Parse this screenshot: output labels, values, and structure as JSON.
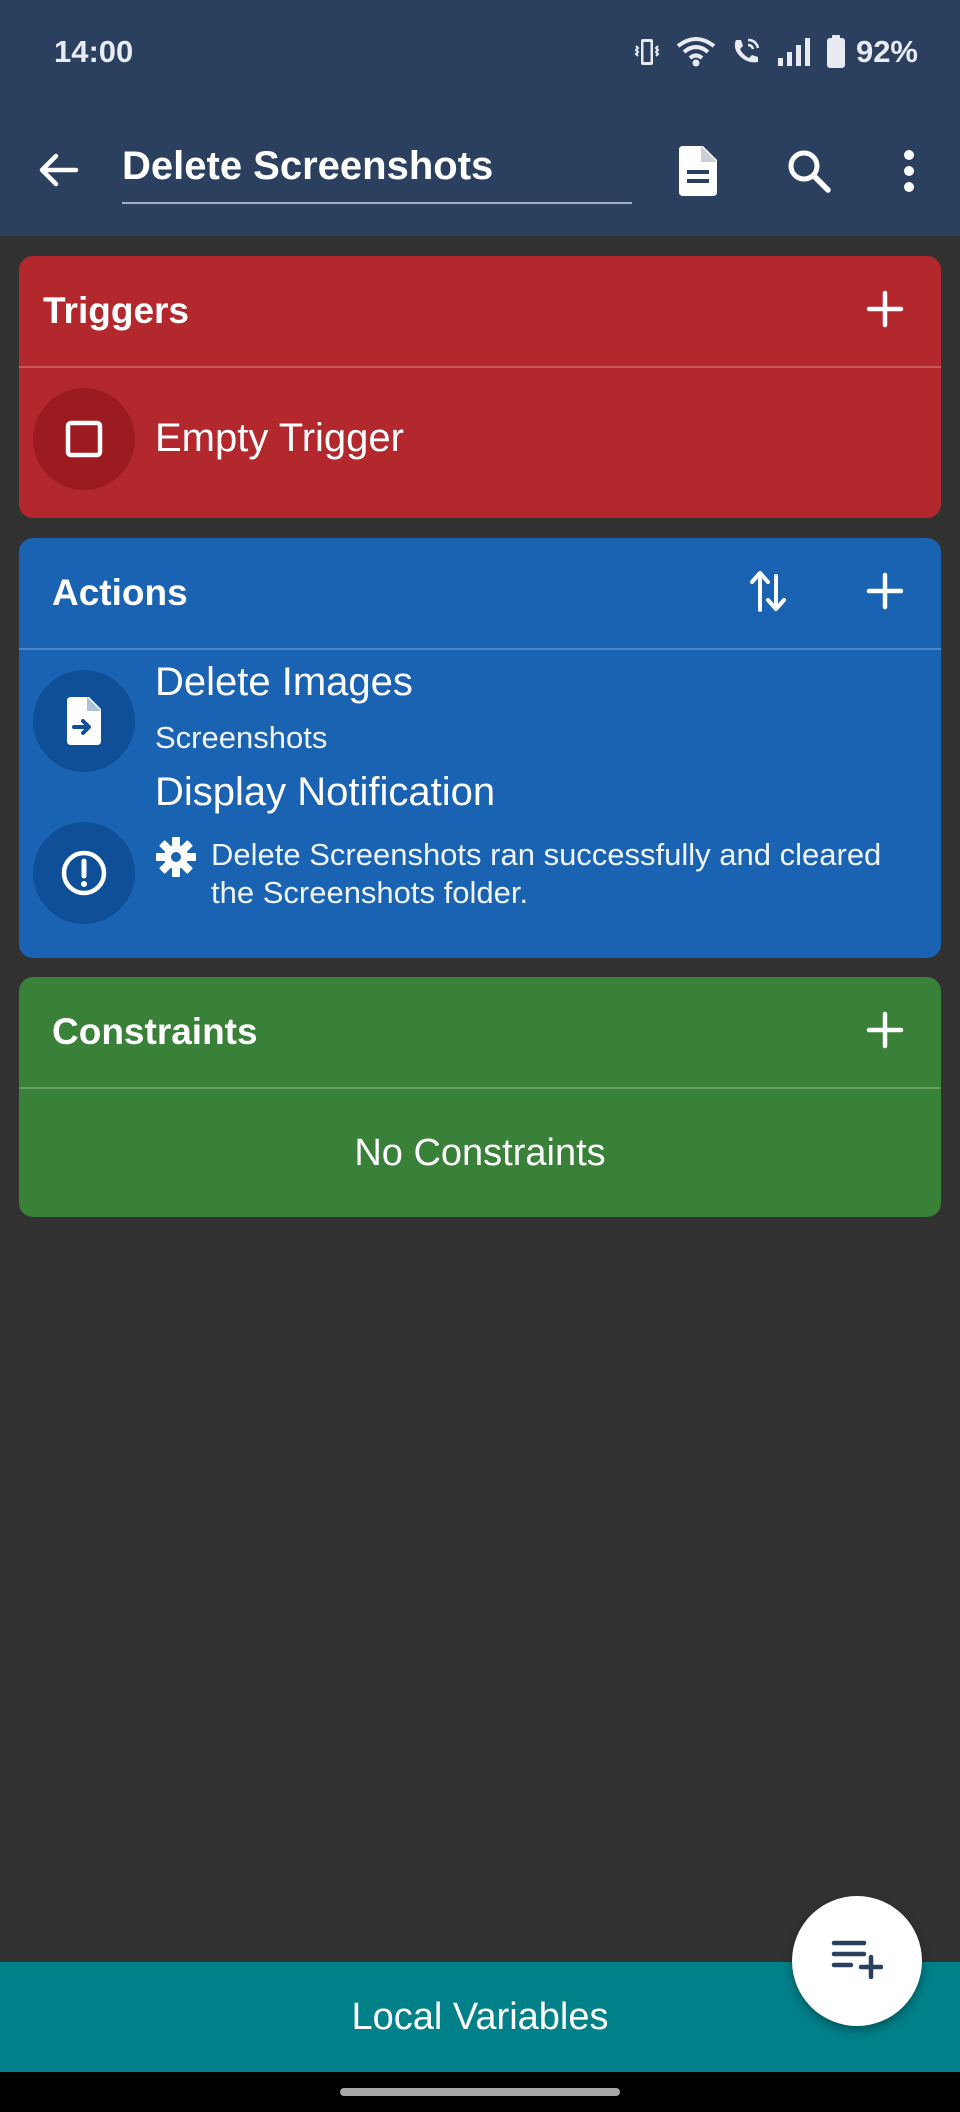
{
  "status_bar": {
    "time": "14:00",
    "battery": "92%"
  },
  "app_bar": {
    "title": "Delete Screenshots",
    "icons": [
      "back-arrow-icon",
      "document-icon",
      "search-icon",
      "more-vert-icon"
    ]
  },
  "triggers": {
    "title": "Triggers",
    "color": "#b3282d",
    "items": [
      {
        "icon": "checkbox-blank-icon",
        "title": "Empty Trigger"
      }
    ]
  },
  "actions": {
    "title": "Actions",
    "color": "#1a63b3",
    "items": [
      {
        "icon": "file-move-icon",
        "title": "Delete Images",
        "subtitle": "Screenshots"
      },
      {
        "icon": "alert-circle-icon",
        "title": "Display Notification",
        "subtitle": "Delete Screenshots ran successfully and cleared the Screenshots folder.",
        "subtitle_icon": "gear-icon"
      }
    ]
  },
  "constraints": {
    "title": "Constraints",
    "color": "#398138",
    "empty_text": "No Constraints"
  },
  "bottom": {
    "local_variables": "Local Variables",
    "fab_icon": "playlist-add-icon"
  }
}
